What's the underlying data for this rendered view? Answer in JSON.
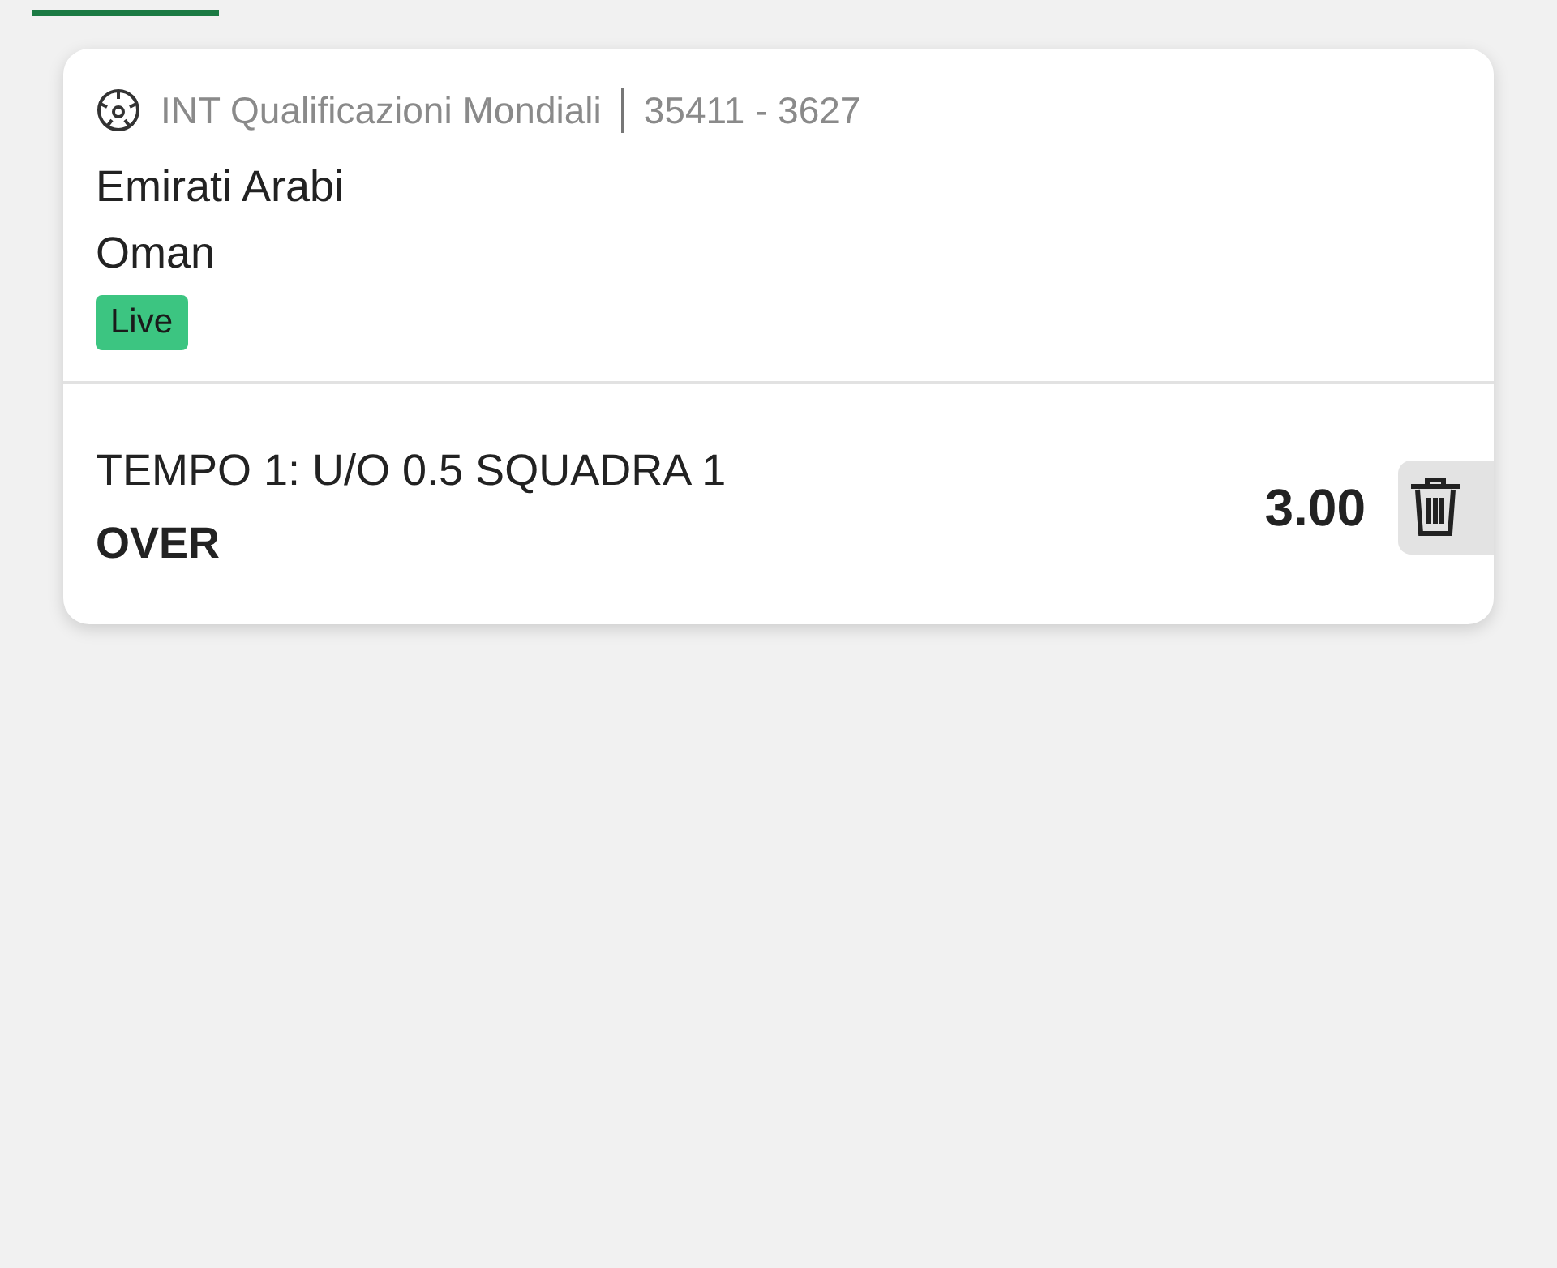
{
  "event": {
    "competition": "INT Qualificazioni Mondiali",
    "code": "35411 - 3627",
    "teams": [
      "Emirati Arabi",
      "Oman"
    ],
    "badge": "Live"
  },
  "selection": {
    "market": "TEMPO 1: U/O 0.5 SQUADRA 1",
    "outcome": "OVER",
    "odds": "3.00"
  }
}
